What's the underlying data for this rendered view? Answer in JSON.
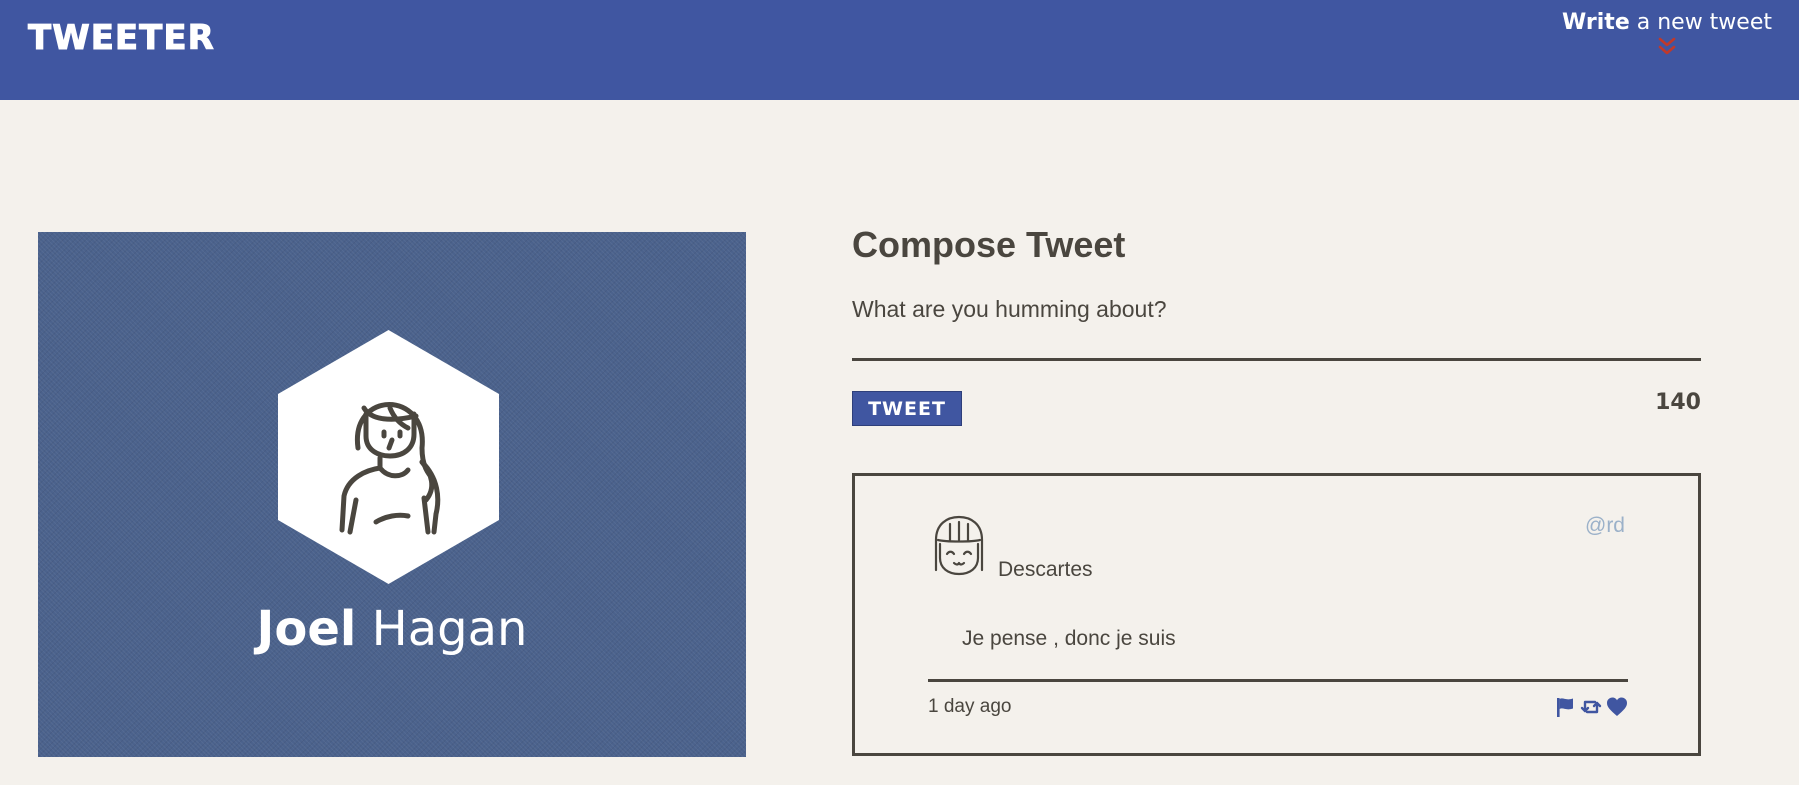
{
  "nav": {
    "brand": "TWEETER",
    "write_strong": "Write",
    "write_rest": " a new tweet",
    "toggle_icon": "double-chevron-down-icon",
    "accent_color": "#c0392b",
    "background_color": "#4056a1"
  },
  "profile": {
    "avatar_icon": "woman-avatar-icon",
    "first_name": "Joel",
    "last_name": "Hagan"
  },
  "compose": {
    "title": "Compose Tweet",
    "placeholder": "What are you humming about?",
    "tweet_button": "TWEET",
    "char_counter": "140"
  },
  "tweet": {
    "avatar_icon": "girl-avatar-icon",
    "author": "Descartes",
    "handle": "@rd",
    "body": "Je pense , donc je suis",
    "timestamp": "1 day ago",
    "actions": [
      "flag-icon",
      "retweet-icon",
      "heart-icon"
    ],
    "action_color": "#4056a1"
  },
  "colors": {
    "page_background": "#f4f1ec",
    "text": "#4a463f",
    "handle": "#9bb1c9"
  }
}
